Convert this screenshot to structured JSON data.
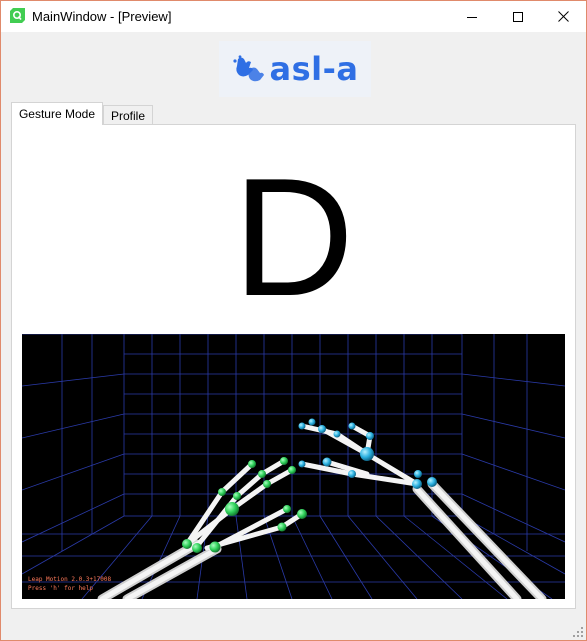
{
  "window": {
    "title": "MainWindow - [Preview]",
    "icon": "qt-icon"
  },
  "logo": {
    "text": "asl-a",
    "icon": "sign-language-hands-icon",
    "brand_color": "#2f6fe4"
  },
  "tabs": [
    {
      "label": "Gesture Mode",
      "active": true
    },
    {
      "label": "Profile",
      "active": false
    }
  ],
  "gesture": {
    "recognized_letter": "D"
  },
  "visualizer": {
    "info_line1": "Leap Motion 2.0.3+17008",
    "info_line2": "Press 'h' for help",
    "grid_color": "#2a3aa8",
    "left_hand_color": "#2fd15a",
    "right_hand_color": "#2ab0e0"
  }
}
